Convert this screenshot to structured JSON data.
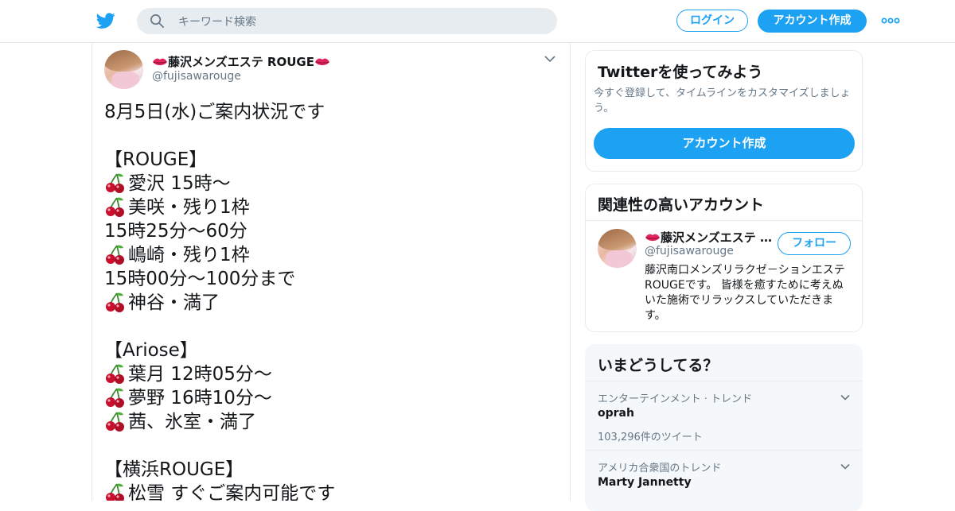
{
  "header": {
    "search_placeholder": "キーワード検索",
    "login_label": "ログイン",
    "signup_label": "アカウント作成"
  },
  "tweet": {
    "display_name": "藤沢メンズエステ ROUGE",
    "handle": "@fujisawarouge",
    "lines": [
      {
        "cherry": false,
        "text": "8月5日(水)ご案内状況です"
      },
      {
        "cherry": false,
        "text": ""
      },
      {
        "cherry": false,
        "text": "【ROUGE】"
      },
      {
        "cherry": true,
        "text": "愛沢 15時～"
      },
      {
        "cherry": true,
        "text": "美咲・残り1枠"
      },
      {
        "cherry": false,
        "text": "15時25分～60分"
      },
      {
        "cherry": true,
        "text": "嶋崎・残り1枠"
      },
      {
        "cherry": false,
        "text": "15時00分～100分まで"
      },
      {
        "cherry": true,
        "text": "神谷・満了"
      },
      {
        "cherry": false,
        "text": ""
      },
      {
        "cherry": false,
        "text": "【Ariose】"
      },
      {
        "cherry": true,
        "text": "葉月 12時05分～"
      },
      {
        "cherry": true,
        "text": "夢野 16時10分～"
      },
      {
        "cherry": true,
        "text": "茜、氷室・満了"
      },
      {
        "cherry": false,
        "text": ""
      },
      {
        "cherry": false,
        "text": "【横浜ROUGE】"
      },
      {
        "cherry": true,
        "text": "松雪 すぐご案内可能です"
      }
    ]
  },
  "signup_card": {
    "title": "Twitterを使ってみよう",
    "description": "今すぐ登録して、タイムラインをカスタマイズしましょう。",
    "button_label": "アカウント作成"
  },
  "related_card": {
    "title": "関連性の高いアカウント",
    "account_name": "藤沢メンズエステ ROUGE",
    "account_handle": "@fujisawarouge",
    "follow_label": "フォロー",
    "bio": "藤沢南口メンズリラクゼ－ションエステROUGEです。 皆様を癒すために考えぬいた施術でリラックスしていただきます。"
  },
  "trends_card": {
    "title": "いまどうしてる？",
    "trends": [
      {
        "context": "エンターテインメント · トレンド",
        "name": "oprah",
        "count": "103,296件のツイート"
      },
      {
        "context": "アメリカ合衆国のトレンド",
        "name": "Marty Jannetty",
        "count": ""
      }
    ]
  },
  "colors": {
    "accent": "#1da1f2",
    "text": "#14171a",
    "secondary_text": "#657786",
    "border": "#e6ecf0",
    "trends_bg": "#f5f8fa",
    "lips": "#e0245e",
    "cherry": "#c8102e",
    "stem": "#3a8a2a"
  },
  "icons": {
    "logo": "twitter-bird-icon",
    "search": "search-icon",
    "more": "more-dots-icon",
    "caret": "chevron-down-icon",
    "lips": "lips-emoji-icon",
    "cherry": "cherries-emoji-icon"
  }
}
